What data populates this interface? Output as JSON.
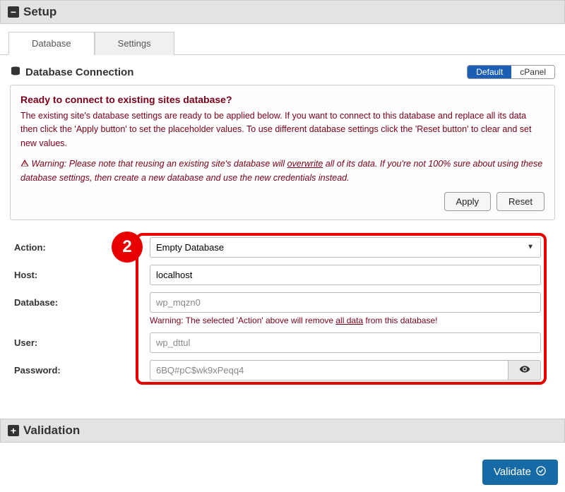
{
  "setup": {
    "title": "Setup",
    "tabs": [
      {
        "label": "Database",
        "active": true
      },
      {
        "label": "Settings",
        "active": false
      }
    ],
    "section_title": "Database Connection",
    "mode": {
      "options": [
        "Default",
        "cPanel"
      ],
      "active": "Default"
    },
    "notice": {
      "heading": "Ready to connect to existing sites database?",
      "body": "The existing site's database settings are ready to be applied below. If you want to connect to this database and replace all its data then click the 'Apply button' to set the placeholder values. To use different database settings click the 'Reset button' to clear and set new values.",
      "warning_prefix": "Warning: Please note that reusing an existing site's database will ",
      "warning_underlined": "overwrite",
      "warning_suffix": " all of its data. If you're not 100% sure about using these database settings, then create a new database and use the new credentials instead.",
      "apply_label": "Apply",
      "reset_label": "Reset"
    },
    "step_badge": "2",
    "fields": {
      "action": {
        "label": "Action:",
        "value": "Empty Database"
      },
      "host": {
        "label": "Host:",
        "value": "localhost"
      },
      "database": {
        "label": "Database:",
        "placeholder": "wp_mqzn0"
      },
      "db_warning_prefix": "Warning: The selected 'Action' above will remove ",
      "db_warning_underlined": "all data",
      "db_warning_suffix": " from this database!",
      "user": {
        "label": "User:",
        "placeholder": "wp_dttul"
      },
      "password": {
        "label": "Password:",
        "placeholder": "6BQ#pC$wk9xPeqq4"
      }
    }
  },
  "validation": {
    "title": "Validation"
  },
  "validate_button": "Validate"
}
